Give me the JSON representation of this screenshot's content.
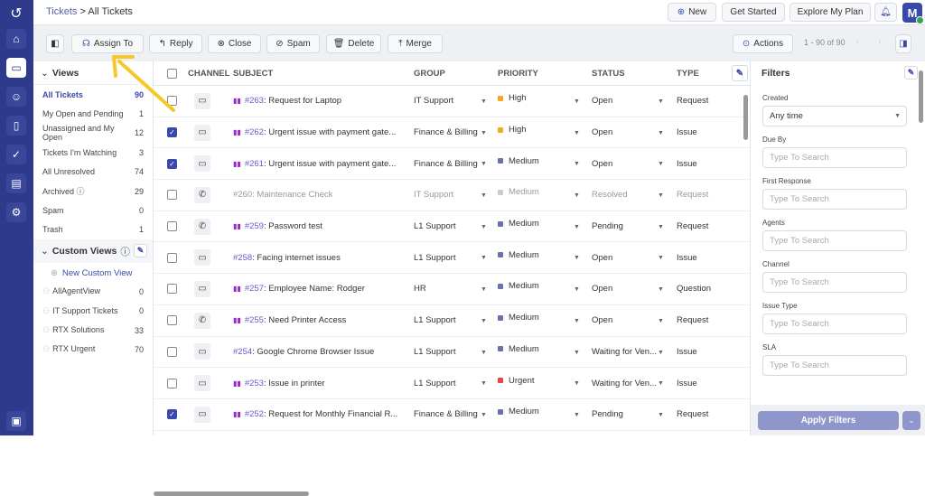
{
  "breadcrumb": {
    "root": "Tickets",
    "separator": ">",
    "current": "All Tickets"
  },
  "header": {
    "new": "New",
    "get_started": "Get Started",
    "explore": "Explore My Plan",
    "avatar": "M"
  },
  "toolbar": {
    "assign": "Assign To",
    "reply": "Reply",
    "close": "Close",
    "spam": "Spam",
    "delete": "Delete",
    "merge": "Merge",
    "actions": "Actions",
    "pagination": "1 - 90 of 90"
  },
  "views": {
    "title": "Views",
    "items": [
      {
        "label": "All Tickets",
        "count": "90"
      },
      {
        "label": "My Open and Pending",
        "count": "1"
      },
      {
        "label": "Unassigned and My Open",
        "count": "12"
      },
      {
        "label": "Tickets I'm Watching",
        "count": "3"
      },
      {
        "label": "All Unresolved",
        "count": "74"
      },
      {
        "label": "Archived",
        "count": "29"
      },
      {
        "label": "Spam",
        "count": "0"
      },
      {
        "label": "Trash",
        "count": "1"
      }
    ]
  },
  "custom_views": {
    "title": "Custom Views",
    "new_label": "New Custom View",
    "items": [
      {
        "label": "AllAgentView",
        "count": "0"
      },
      {
        "label": "IT Support Tickets",
        "count": "0"
      },
      {
        "label": "RTX Solutions",
        "count": "33"
      },
      {
        "label": "RTX Urgent",
        "count": "70"
      }
    ]
  },
  "table": {
    "columns": [
      "CHANNEL",
      "SUBJECT",
      "GROUP",
      "PRIORITY",
      "STATUS",
      "TYPE"
    ],
    "rows": [
      {
        "checked": false,
        "channel": "web",
        "tag": true,
        "id": "#263",
        "subject": ": Request for Laptop",
        "group": "IT Support",
        "priority": "High",
        "status": "Open",
        "type": "Request",
        "dim": false
      },
      {
        "checked": true,
        "channel": "web",
        "tag": true,
        "id": "#262",
        "subject": ": Urgent issue with payment gate...",
        "group": "Finance & Billing",
        "priority": "High",
        "status": "Open",
        "type": "Issue",
        "dim": false
      },
      {
        "checked": true,
        "channel": "web",
        "tag": true,
        "id": "#261",
        "subject": ": Urgent issue with payment gate...",
        "group": "Finance & Billing",
        "priority": "Medium",
        "status": "Open",
        "type": "Issue",
        "dim": false
      },
      {
        "checked": false,
        "channel": "phone",
        "tag": false,
        "id": "#260",
        "subject": ": Maintenance Check",
        "group": "IT Support",
        "priority": "Medium",
        "status": "Resolved",
        "type": "Request",
        "dim": true
      },
      {
        "checked": false,
        "channel": "phone",
        "tag": true,
        "id": "#259",
        "subject": ": Password test",
        "group": "L1 Support",
        "priority": "Medium",
        "status": "Pending",
        "type": "Request",
        "dim": false
      },
      {
        "checked": false,
        "channel": "web",
        "tag": false,
        "id": "#258",
        "subject": ": Facing internet issues",
        "group": "L1 Support",
        "priority": "Medium",
        "status": "Open",
        "type": "Issue",
        "dim": false
      },
      {
        "checked": false,
        "channel": "web",
        "tag": true,
        "id": "#257",
        "subject": ": Employee Name: Rodger",
        "group": "HR",
        "priority": "Medium",
        "status": "Open",
        "type": "Question",
        "dim": false
      },
      {
        "checked": false,
        "channel": "phone",
        "tag": true,
        "id": "#255",
        "subject": ": Need Printer Access",
        "group": "L1 Support",
        "priority": "Medium",
        "status": "Open",
        "type": "Request",
        "dim": false
      },
      {
        "checked": false,
        "channel": "web",
        "tag": false,
        "id": "#254",
        "subject": ": Google Chrome Browser Issue",
        "group": "L1 Support",
        "priority": "Medium",
        "status": "Waiting for Ven...",
        "type": "Issue",
        "dim": false
      },
      {
        "checked": false,
        "channel": "web",
        "tag": true,
        "id": "#253",
        "subject": ": Issue in printer",
        "group": "L1 Support",
        "priority": "Urgent",
        "status": "Waiting for Ven...",
        "type": "Issue",
        "dim": false
      },
      {
        "checked": true,
        "channel": "web",
        "tag": true,
        "id": "#252",
        "subject": ": Request for Monthly Financial R...",
        "group": "Finance & Billing",
        "priority": "Medium",
        "status": "Pending",
        "type": "Request",
        "dim": false
      }
    ]
  },
  "priority_colors": {
    "High": "#f5a623",
    "Medium": "#6b70b0",
    "Urgent": "#e0484b",
    "Dim": "#cccccc"
  },
  "filters": {
    "title": "Filters",
    "created_label": "Created",
    "created_value": "Any time",
    "fields": [
      "Due By",
      "First Response",
      "Agents",
      "Channel",
      "Issue Type",
      "SLA"
    ],
    "placeholder": "Type To Search",
    "apply": "Apply Filters"
  }
}
